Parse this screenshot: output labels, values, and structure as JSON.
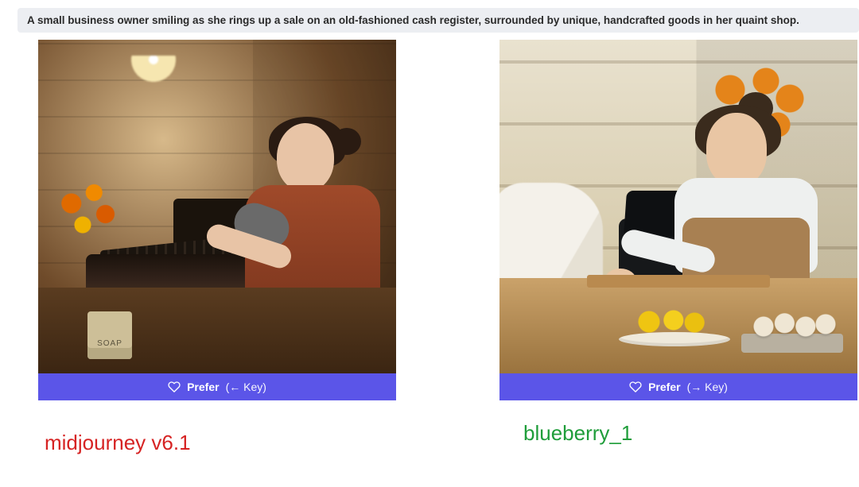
{
  "prompt_banner": "A small business owner smiling as she rings up a sale on an old-fashioned cash register, surrounded by unique, handcrafted goods in her quaint shop.",
  "prefer": {
    "label": "Prefer",
    "left_key_hint": "(← Key)",
    "right_key_hint": "(→ Key)",
    "icon": "heart-outline"
  },
  "models": {
    "left_label": "midjourney v6.1",
    "right_label": "blueberry_1"
  },
  "colors": {
    "banner_bg": "#eceef2",
    "prefer_bar": "#5b55e8",
    "label_left": "#d62323",
    "label_right": "#1f9d3a"
  }
}
